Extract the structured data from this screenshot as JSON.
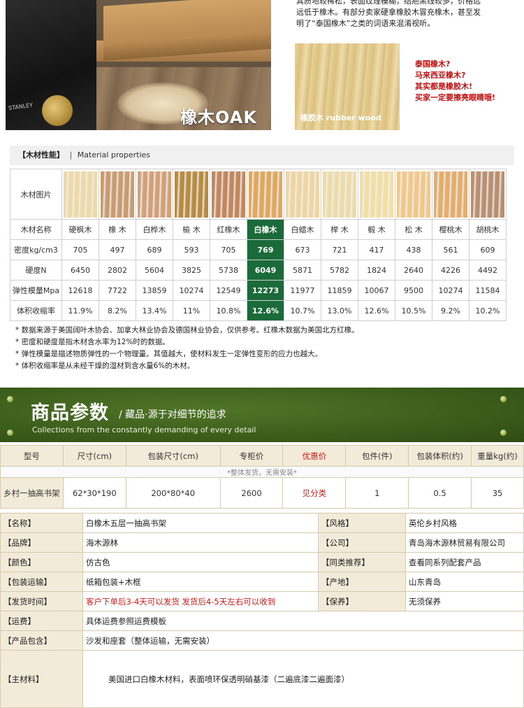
{
  "top": {
    "intro_lines": [
      "其质地较稀松，表面纹理模糊，结疤黑线较多，价格远",
      "远低于橡木。有部分卖家硬拿橡胶木冒充橡木，甚至发",
      "明了“泰国橡木”之类的词语来混淆视听。"
    ],
    "oak_label": "橡木OAK",
    "rubber_label": "橡胶木 rubber wood",
    "plane_brand": "STANLEY",
    "warning_lines": [
      "泰国橡木?",
      "马来西亚橡木?",
      "其实都是橡胶木!",
      "买家一定要擦亮眼睛哦!"
    ]
  },
  "properties": {
    "title_cn": "【木材性能】",
    "title_sep": "|",
    "title_en": "Material properties",
    "row_labels": [
      "木材图片",
      "木材名称",
      "密度kg/cm3",
      "硬度N",
      "弹性模量Mpa",
      "体积收缩率"
    ],
    "woods": [
      {
        "name": "硬枫木",
        "density": "705",
        "hardness": "6450",
        "elasticity": "12618",
        "shrinkage": "11.9%",
        "color": "#eed9a8",
        "selected": false
      },
      {
        "name": "橡 木",
        "density": "497",
        "hardness": "2802",
        "elasticity": "7722",
        "shrinkage": "8.2%",
        "color": "#c99b70",
        "selected": false
      },
      {
        "name": "白桦木",
        "density": "689",
        "hardness": "5604",
        "elasticity": "13859",
        "shrinkage": "13.4%",
        "color": "#d2a17a",
        "selected": false
      },
      {
        "name": "榆 木",
        "density": "593",
        "hardness": "3825",
        "elasticity": "10274",
        "shrinkage": "11%",
        "color": "#b78c42",
        "selected": false
      },
      {
        "name": "红橡木",
        "density": "705",
        "hardness": "5738",
        "elasticity": "12549",
        "shrinkage": "10.8%",
        "color": "#c2875d",
        "selected": false
      },
      {
        "name": "白橡木",
        "density": "769",
        "hardness": "6049",
        "elasticity": "12273",
        "shrinkage": "12.6%",
        "color": "#dfa860",
        "selected": true
      },
      {
        "name": "白蜡木",
        "density": "673",
        "hardness": "5871",
        "elasticity": "11977",
        "shrinkage": "10.7%",
        "color": "#eed5a2",
        "selected": false
      },
      {
        "name": "榉 木",
        "density": "721",
        "hardness": "5782",
        "elasticity": "11859",
        "shrinkage": "13.0%",
        "color": "#ecdcaa",
        "selected": false
      },
      {
        "name": "椴 木",
        "density": "417",
        "hardness": "1824",
        "elasticity": "10067",
        "shrinkage": "12.6%",
        "color": "#f1dfa4",
        "selected": false
      },
      {
        "name": "松 木",
        "density": "438",
        "hardness": "2640",
        "elasticity": "9500",
        "shrinkage": "10.5%",
        "color": "#f0c98a",
        "selected": false
      },
      {
        "name": "樱桃木",
        "density": "561",
        "hardness": "4226",
        "elasticity": "10274",
        "shrinkage": "9.2%",
        "color": "#e4ad6c",
        "selected": false
      },
      {
        "name": "胡桃木",
        "density": "609",
        "hardness": "4492",
        "elasticity": "11584",
        "shrinkage": "10.2%",
        "color": "#b88f6f",
        "selected": false
      }
    ],
    "notes": [
      "* 数据来源于美国阔叶木协会、加拿大林业协会及德国林业协会，仅供参考。红橡木数据为美国北方红橡。",
      "* 密度和硬度是指木材含水率为12%时的数据。",
      "* 弹性模量是描述物质弹性的一个物理量。其值越大，使材料发生一定弹性变形的应力也越大。",
      "* 体积收缩率是从未经干燥的湿材到含水量6%的木材。"
    ]
  },
  "banner": {
    "title": "商品参数",
    "subtitle": "/ 藏品·源于对细节的追求",
    "subtitle_en": "Collections from the constantly demanding of every detail"
  },
  "params": {
    "headers": [
      "型号",
      "尺寸(cm)",
      "包装尺寸(cm)",
      "专柜价",
      "优惠价",
      "包件(件)",
      "包装体积(约)",
      "重量kg(约)"
    ],
    "note": "*整体发货，无需安装*",
    "values": [
      "乡村一抽高书架",
      "62*30*190",
      "200*80*40",
      "2600",
      "见分类",
      "1",
      "0.5",
      "35"
    ]
  },
  "info": {
    "name_label": "【名称】",
    "name_value": "白橡木五层一抽高书架",
    "style_label": "【风格】",
    "style_value": "英伦乡村风格",
    "brand_label": "【品牌】",
    "brand_value": "海木源林",
    "company_label": "【公司】",
    "company_value": "青岛海木源林贸易有限公司",
    "color_label": "【颜色】",
    "color_value": "仿古色",
    "similar_label": "【同类推荐】",
    "similar_value": "查看同系列配套产品",
    "packaging_label": "【包装运输】",
    "packaging_value": "纸箱包装+木框",
    "origin_label": "【产地】",
    "origin_value": "山东青岛",
    "shipping_label": "【发货时间】",
    "shipping_value": "客户下单后3-4天可以发货  发货后4-5天左右可以收到",
    "warranty_label": "【保养】",
    "warranty_value": "无须保养",
    "freight_label": "【运费】",
    "freight_value": "具体运费参照运费模板",
    "includes_label": "【产品包含】",
    "includes_value": "沙发和座套（整体运输，无需安装）",
    "material_label": "【主材料】",
    "material_value": "美国进口白橡木材料，表面喷环保透明硝基漆（二遍底漆二遍面漆）"
  }
}
